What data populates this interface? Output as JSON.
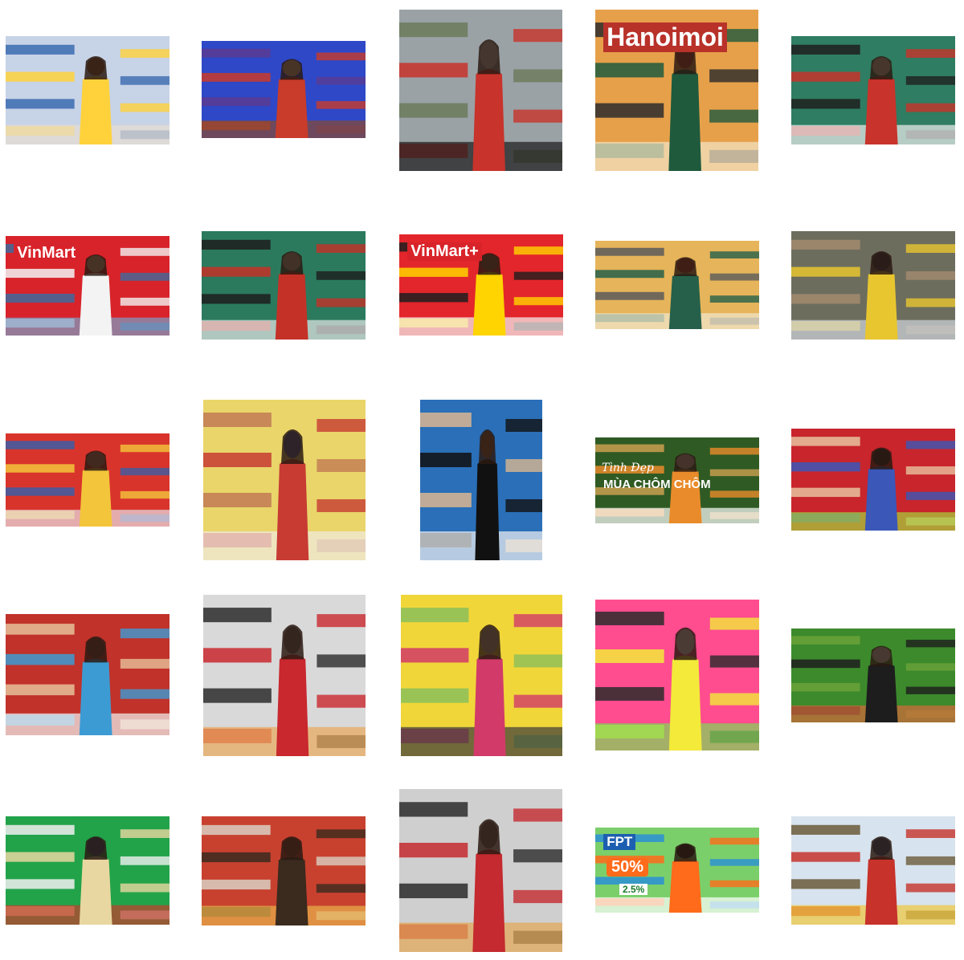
{
  "title": "",
  "photos": [
    {
      "scene": "woman shopping supermarket shelf",
      "palette": [
        "#c7d3e6",
        "#ffd23b",
        "#e7ddd0",
        "#8a5a3a",
        "#3b6bb0"
      ]
    },
    {
      "scene": "woman seated in convenience store, blue light",
      "palette": [
        "#2e48c8",
        "#c93b2a",
        "#8a4a2f",
        "#f2c8a0",
        "#5a3b92"
      ]
    },
    {
      "scene": "woman in red dress at bookstore",
      "palette": [
        "#9aa2a6",
        "#c8332b",
        "#1a1a1a",
        "#d9d9d9",
        "#6b7a5a"
      ]
    },
    {
      "scene": "woman at newspaper board",
      "palette": [
        "#e7a04a",
        "#1f5a3d",
        "#f2e6c8",
        "#b93a2b",
        "#2b2b2b"
      ],
      "sign": "Hanoimoi"
    },
    {
      "scene": "woman with mask using hand sanitizer",
      "palette": [
        "#2f7d62",
        "#c8332b",
        "#f0f0f0",
        "#e9d4b8",
        "#1f1f1f"
      ]
    },
    {
      "scene": "woman in VinMart aisle with phone",
      "palette": [
        "#d8232a",
        "#f3f3f3",
        "#7c9fc7",
        "#e0c39a",
        "#3f6a9e"
      ],
      "sign": "VinMart"
    },
    {
      "scene": "masked woman sanitizing hands",
      "palette": [
        "#2b7a5e",
        "#c43127",
        "#e8e8e8",
        "#c9b39a",
        "#1d1d1d"
      ]
    },
    {
      "scene": "woman outside VinMart+ store",
      "palette": [
        "#e3262b",
        "#ffd400",
        "#f5f5f5",
        "#8a4f35",
        "#1e1e1e"
      ],
      "sign": "VinMart+"
    },
    {
      "scene": "woman at newspaper display",
      "palette": [
        "#e6b45a",
        "#26604a",
        "#f1e8d0",
        "#b03a2c",
        "#5b5b5b"
      ]
    },
    {
      "scene": "cashier at supermarket checkout",
      "palette": [
        "#6d6d5e",
        "#e8c62f",
        "#d0d6db",
        "#2b3342",
        "#a38b6e"
      ]
    },
    {
      "scene": "woman with mask at red snack shelves",
      "palette": [
        "#d9342b",
        "#f3c53b",
        "#e8e0e6",
        "#c6836f",
        "#3b5ea6"
      ]
    },
    {
      "scene": "woman in yellow in mini mart",
      "palette": [
        "#e9d56a",
        "#c73b33",
        "#f0ebe3",
        "#3d5aa5",
        "#c27a54"
      ]
    },
    {
      "scene": "girl in blue dress on checkered floor",
      "palette": [
        "#2a6fb8",
        "#111111",
        "#f2f2f2",
        "#8a5a3a",
        "#d9b690"
      ]
    },
    {
      "scene": "woman picking rambutan fruit",
      "palette": [
        "#2f5a23",
        "#e98b2a",
        "#ffffff",
        "#d7b9b9",
        "#caa050"
      ],
      "caption_script": "Tình Đẹp",
      "caption": "MÙA CHÔM CHÔM"
    },
    {
      "scene": "spokeswoman at podium",
      "palette": [
        "#c8252c",
        "#3b57b8",
        "#a5d23b",
        "#1e1e1e",
        "#e8c2a0"
      ]
    },
    {
      "scene": "masked staff picking items into red basket",
      "palette": [
        "#c0322a",
        "#3d9bd4",
        "#f3f3f3",
        "#6a3b2a",
        "#e6c09a"
      ]
    },
    {
      "scene": "woman with flower bouquet in square",
      "palette": [
        "#d9d9d9",
        "#c8282e",
        "#e9a85a",
        "#6a6a6a",
        "#2b2b2b"
      ]
    },
    {
      "scene": "woman with flowers at market stall",
      "palette": [
        "#f1d63a",
        "#d23b69",
        "#3b3b3b",
        "#c8b59a",
        "#8bbf5a"
      ]
    },
    {
      "scene": "women at shampoo shelves",
      "palette": [
        "#ff4d8f",
        "#f3ea3a",
        "#7ed957",
        "#ffffff",
        "#2b2b2b"
      ]
    },
    {
      "scene": "woman scanning QR at vegetables",
      "palette": [
        "#3c8a2c",
        "#1d1d1d",
        "#d56a3a",
        "#e8e8e8",
        "#6aa13a"
      ]
    },
    {
      "scene": "couple shopping in green store",
      "palette": [
        "#22a34a",
        "#e8d7a0",
        "#c43c2c",
        "#2c3e7a",
        "#f0f0f0"
      ]
    },
    {
      "scene": "woman at souvenir shop",
      "palette": [
        "#c8412f",
        "#3b2a1e",
        "#e8b24a",
        "#7a3a2a",
        "#d9d0c2"
      ]
    },
    {
      "scene": "woman with bouquet at square",
      "palette": [
        "#cfcfcf",
        "#c42a2f",
        "#e3a654",
        "#6a6a6a",
        "#2b2b2b"
      ]
    },
    {
      "scene": "FPT Shop promotion banner",
      "palette": [
        "#7bcf6a",
        "#ff6b1a",
        "#ffffff",
        "#1a1a1a",
        "#2a8fd6"
      ],
      "sign": "FPT",
      "promo": "50%",
      "promo2": "2.5%"
    },
    {
      "scene": "staff handing goods at store counter",
      "palette": [
        "#d7e3ee",
        "#c7322b",
        "#f0c63a",
        "#2e4f8a",
        "#6b5a3a"
      ]
    }
  ]
}
